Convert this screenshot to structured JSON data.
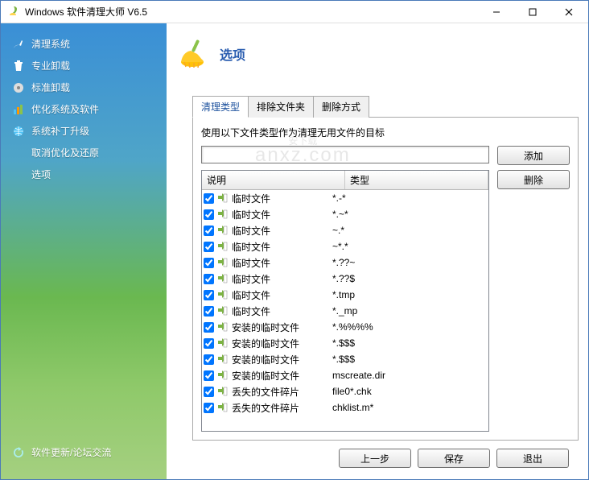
{
  "window": {
    "title": "Windows 软件清理大师 V6.5"
  },
  "sidebar": {
    "items": [
      {
        "label": "清理系统",
        "icon": "broom-icon"
      },
      {
        "label": "专业卸载",
        "icon": "trash-icon"
      },
      {
        "label": "标准卸载",
        "icon": "disc-icon"
      },
      {
        "label": "优化系统及软件",
        "icon": "chart-icon"
      },
      {
        "label": "系统补丁升级",
        "icon": "globe-icon"
      },
      {
        "label": "取消优化及还原",
        "icon": ""
      },
      {
        "label": "选项",
        "icon": ""
      }
    ],
    "bottom": {
      "label": "软件更新/论坛交流",
      "icon": "refresh-icon"
    }
  },
  "header": {
    "title": "选项"
  },
  "tabs": [
    {
      "label": "清理类型",
      "active": true
    },
    {
      "label": "排除文件夹",
      "active": false
    },
    {
      "label": "删除方式",
      "active": false
    }
  ],
  "panel": {
    "description": "使用以下文件类型作为清理无用文件的目标",
    "input_value": "",
    "add_button": "添加",
    "delete_button": "删除",
    "columns": {
      "c1": "说明",
      "c2": "类型"
    },
    "rows": [
      {
        "checked": true,
        "desc": "临时文件",
        "type": "*.-*"
      },
      {
        "checked": true,
        "desc": "临时文件",
        "type": "*.~*"
      },
      {
        "checked": true,
        "desc": "临时文件",
        "type": "~.*"
      },
      {
        "checked": true,
        "desc": "临时文件",
        "type": "~*.*"
      },
      {
        "checked": true,
        "desc": "临时文件",
        "type": "*.??~"
      },
      {
        "checked": true,
        "desc": "临时文件",
        "type": "*.??$"
      },
      {
        "checked": true,
        "desc": "临时文件",
        "type": "*.tmp"
      },
      {
        "checked": true,
        "desc": "临时文件",
        "type": "*._mp"
      },
      {
        "checked": true,
        "desc": "安装的临时文件",
        "type": "*.%%%%"
      },
      {
        "checked": true,
        "desc": "安装的临时文件",
        "type": "*.$$$"
      },
      {
        "checked": true,
        "desc": "安装的临时文件",
        "type": "*.$$$"
      },
      {
        "checked": true,
        "desc": "安装的临时文件",
        "type": "mscreate.dir"
      },
      {
        "checked": true,
        "desc": "丢失的文件碎片",
        "type": "file0*.chk"
      },
      {
        "checked": true,
        "desc": "丢失的文件碎片",
        "type": "chklist.m*"
      }
    ]
  },
  "footer": {
    "prev": "上一步",
    "save": "保存",
    "exit": "退出"
  },
  "watermark": {
    "line1": "安下载",
    "line2": "anxz.com"
  }
}
